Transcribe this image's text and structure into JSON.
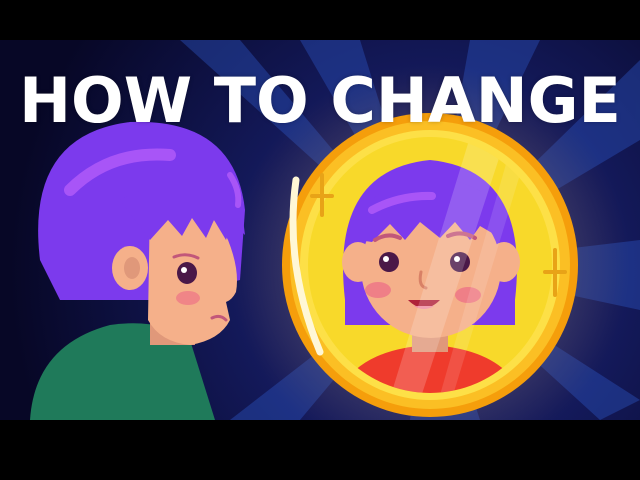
{
  "headline": "HOW TO CHANGE",
  "colors": {
    "background_dark": "#0a0a2e",
    "ray_light": "#1f3a8a",
    "hair": "#7c3aed",
    "hair_highlight": "#a855f7",
    "skin": "#f5b08a",
    "skin_shadow": "#e0987a",
    "cheek": "#ec6f86",
    "shirt_left": "#1f7a5a",
    "shirt_reflection": "#ef3b2c",
    "mirror_frame_outer": "#f59e0b",
    "mirror_frame_inner": "#fde047",
    "letterbox": "#000000"
  },
  "icons": [
    "person-side-view",
    "mirror",
    "reflection-face"
  ]
}
